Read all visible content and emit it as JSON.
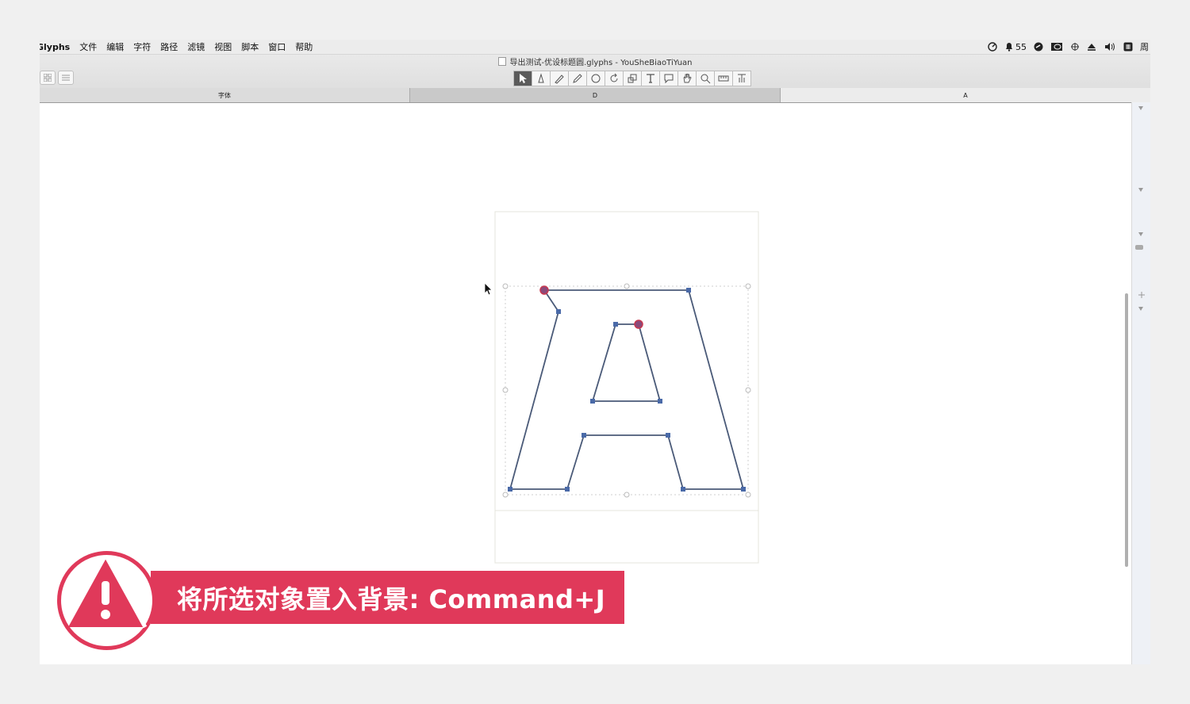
{
  "menubar": {
    "app_name": "Glyphs",
    "items": [
      "文件",
      "编辑",
      "字符",
      "路径",
      "滤镜",
      "视图",
      "脚本",
      "窗口",
      "帮助"
    ],
    "status": {
      "notification_count": "55",
      "trailing_char": "周"
    }
  },
  "window": {
    "title": "导出测试-优设标题圆.glyphs - YouSheBiaoTiYuan"
  },
  "tabs": [
    {
      "label": "字体"
    },
    {
      "label": "D"
    },
    {
      "label": "A"
    }
  ],
  "toolbar": {
    "tools": [
      "select-tool",
      "draw-tool",
      "pen-tool",
      "pencil-tool",
      "primitives-tool",
      "rotate-tool",
      "scale-tool",
      "text-tool",
      "annotation-tool",
      "hand-tool",
      "zoom-tool",
      "measurement-tool",
      "text-stroke-tool"
    ],
    "active_tool": "select-tool"
  },
  "banner": {
    "text": "将所选对象置入背景: Command+J",
    "color": "#e0395a"
  },
  "colors": {
    "outline": "#4a5a78",
    "node": "#4a6aa8",
    "selected_node": "#c8374f"
  }
}
